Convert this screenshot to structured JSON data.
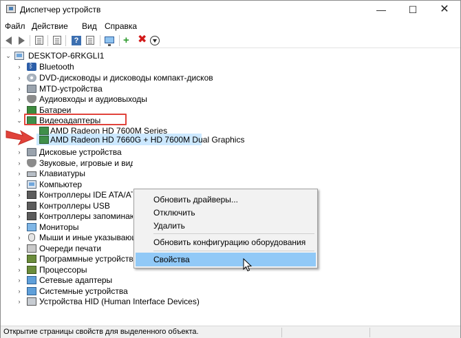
{
  "window": {
    "title": "Диспетчер устройств",
    "controls": {
      "minimize": "—",
      "maximize": "☐",
      "close": "✕"
    }
  },
  "menu": [
    "Файл",
    "Действие",
    "Вид",
    "Справка"
  ],
  "toolbar_icons": [
    "back-arrow-icon",
    "forward-arrow-icon",
    "properties-icon",
    "list-icon",
    "help-icon",
    "details-icon",
    "monitor-icon",
    "add-driver-icon",
    "remove-device-icon",
    "update-driver-icon"
  ],
  "tree": {
    "root": "DESKTOP-6RKGLI1",
    "categories": [
      {
        "label": "Bluetooth",
        "icon": "bluetooth-icon"
      },
      {
        "label": "DVD-дисководы и дисководы компакт-дисков",
        "icon": "disc-drive-icon"
      },
      {
        "label": "MTD-устройства",
        "icon": "storage-icon"
      },
      {
        "label": "Аудиовходы и аудиовыходы",
        "icon": "audio-icon"
      },
      {
        "label": "Батареи",
        "icon": "battery-icon"
      },
      {
        "label": "Видеоадаптеры",
        "icon": "display-adapter-icon",
        "expanded": true,
        "children": [
          "AMD Radeon HD 7600M Series",
          "AMD Radeon HD 7660G + HD 7600M Dual Graphics"
        ]
      },
      {
        "label": "Дисковые устройства",
        "icon": "disk-drive-icon"
      },
      {
        "label": "Звуковые, игровые и видеоустройства",
        "icon": "sound-icon"
      },
      {
        "label": "Клавиатуры",
        "icon": "keyboard-icon"
      },
      {
        "label": "Компьютер",
        "icon": "computer-icon"
      },
      {
        "label": "Контроллеры IDE ATA/ATAPI",
        "icon": "ide-controller-icon"
      },
      {
        "label": "Контроллеры USB",
        "icon": "usb-controller-icon"
      },
      {
        "label": "Контроллеры запоминающих устройств",
        "icon": "storage-controller-icon"
      },
      {
        "label": "Мониторы",
        "icon": "monitor-icon"
      },
      {
        "label": "Мыши и иные указывающие устройства",
        "icon": "mouse-icon"
      },
      {
        "label": "Очереди печати",
        "icon": "printer-icon"
      },
      {
        "label": "Программные устройства",
        "icon": "software-device-icon"
      },
      {
        "label": "Процессоры",
        "icon": "processor-icon"
      },
      {
        "label": "Сетевые адаптеры",
        "icon": "network-adapter-icon"
      },
      {
        "label": "Системные устройства",
        "icon": "system-device-icon"
      },
      {
        "label": "Устройства HID (Human Interface Devices)",
        "icon": "hid-icon"
      }
    ]
  },
  "context_menu": {
    "items": [
      "Обновить драйверы...",
      "Отключить",
      "Удалить",
      "Обновить конфигурацию оборудования",
      "Свойства"
    ],
    "active_item": "Свойства"
  },
  "status_bar": {
    "text": "Открытие страницы свойств для выделенного объекта."
  },
  "colors": {
    "selection": "#cce8ff",
    "menu_hover": "#91c9f7",
    "annotation_red": "#e0423a"
  }
}
